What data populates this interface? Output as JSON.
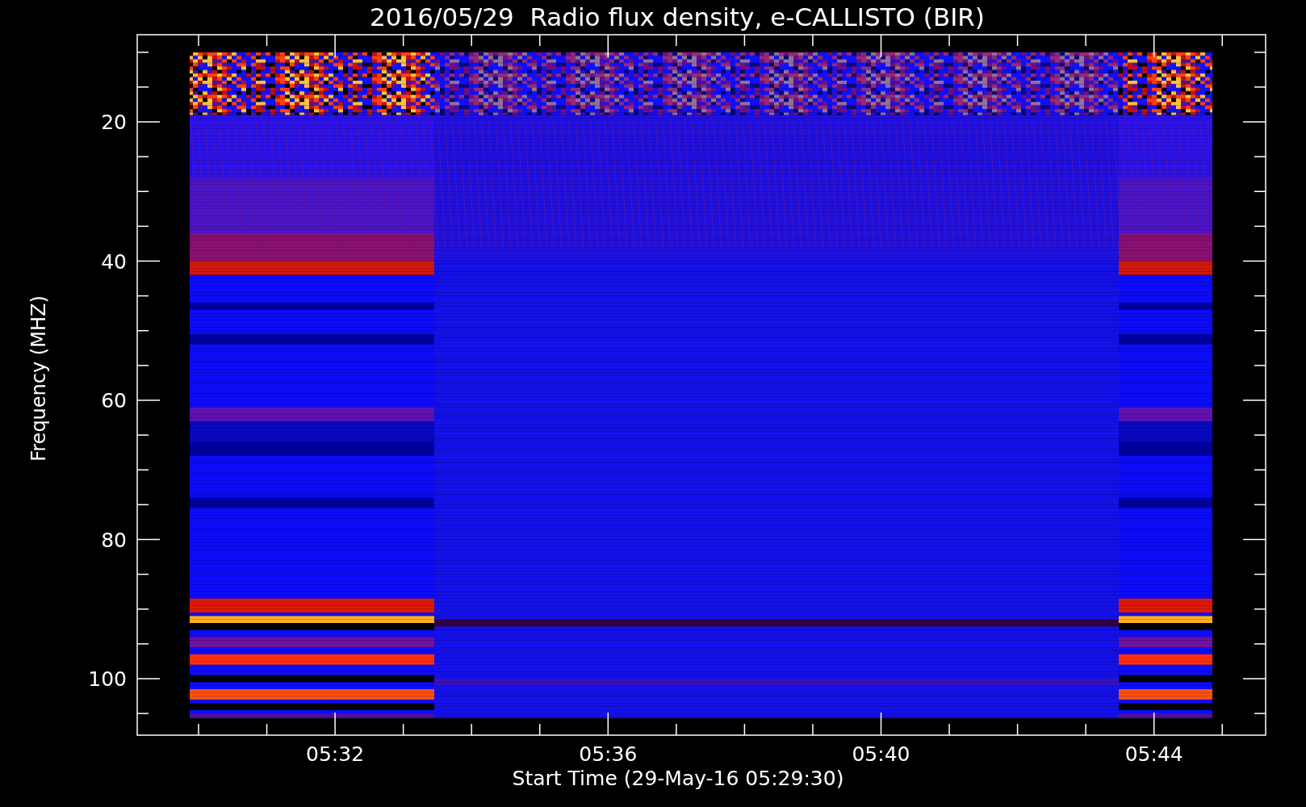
{
  "title": "2016/05/29  Radio flux density, e-CALLISTO (BIR)",
  "y_axis": {
    "title": "Frequency (MHZ)",
    "tick_labels": [
      "20",
      "40",
      "60",
      "80",
      "100"
    ]
  },
  "x_axis": {
    "title": "Start Time (29-May-16 05:29:30)",
    "tick_labels": [
      "05:32",
      "05:36",
      "05:40",
      "05:44"
    ]
  }
}
